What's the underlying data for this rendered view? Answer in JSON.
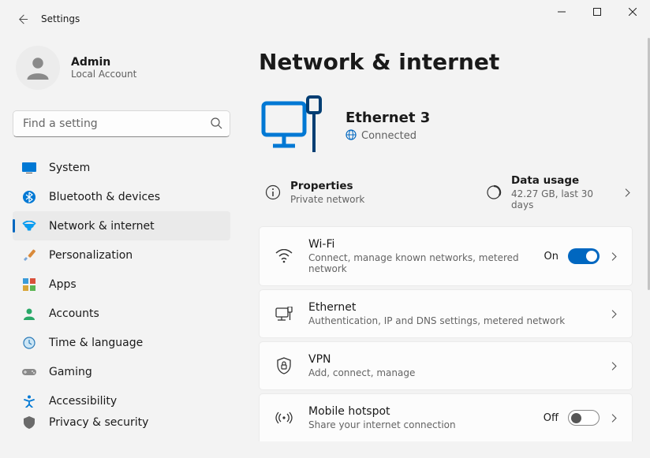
{
  "window": {
    "title": "Settings"
  },
  "profile": {
    "name": "Admin",
    "sub": "Local Account"
  },
  "search": {
    "placeholder": "Find a setting"
  },
  "nav": {
    "items": [
      {
        "label": "System"
      },
      {
        "label": "Bluetooth & devices"
      },
      {
        "label": "Network & internet"
      },
      {
        "label": "Personalization"
      },
      {
        "label": "Apps"
      },
      {
        "label": "Accounts"
      },
      {
        "label": "Time & language"
      },
      {
        "label": "Gaming"
      },
      {
        "label": "Accessibility"
      },
      {
        "label": "Privacy & security"
      }
    ],
    "selected_index": 2
  },
  "page": {
    "heading": "Network & internet",
    "connection": {
      "name": "Ethernet 3",
      "status": "Connected"
    },
    "properties": {
      "title": "Properties",
      "sub": "Private network"
    },
    "data_usage": {
      "title": "Data usage",
      "sub": "42.27 GB, last 30 days"
    },
    "cards": {
      "wifi": {
        "title": "Wi-Fi",
        "sub": "Connect, manage known networks, metered network",
        "toggle_state": "on",
        "toggle_label": "On"
      },
      "eth": {
        "title": "Ethernet",
        "sub": "Authentication, IP and DNS settings, metered network"
      },
      "vpn": {
        "title": "VPN",
        "sub": "Add, connect, manage"
      },
      "hotspot": {
        "title": "Mobile hotspot",
        "sub": "Share your internet connection",
        "toggle_state": "off",
        "toggle_label": "Off"
      }
    }
  }
}
